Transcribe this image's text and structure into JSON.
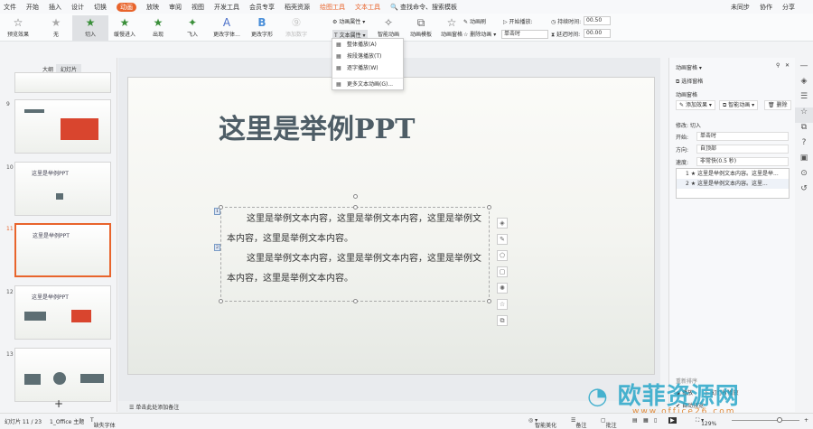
{
  "menubar": {
    "items": [
      "文件",
      "开始",
      "插入",
      "设计",
      "切换",
      "动画",
      "放映",
      "审阅",
      "视图",
      "开发工具",
      "会员专享",
      "稻壳资源"
    ],
    "active": "动画",
    "context_tabs": [
      "绘图工具",
      "文本工具"
    ],
    "search": "查找命令、搜索模板",
    "right": [
      "未同步",
      "协作",
      "分享"
    ]
  },
  "ribbon": {
    "preview": "预览效果",
    "effects": [
      "无",
      "切入",
      "缓慢进入",
      "出现",
      "飞入",
      "更改字体...",
      "更改字形",
      "添加数字"
    ],
    "anim_props": "动画属性",
    "text_props": "文本属性",
    "smart_anim": "智能动画",
    "anim_template": "动画模板",
    "anim_pane": "动画窗格",
    "anim_brush": "动画刷",
    "delete_anim": "删除动画",
    "start_play": "开始播放:",
    "start_value": "单击时",
    "duration_label": "持续时间:",
    "duration": "00.50",
    "delay_label": "延迟时间:",
    "delay": "00.00"
  },
  "dropdown": {
    "items": [
      "整体播放(A)",
      "按段落播放(T)",
      "逐字播放(W)"
    ],
    "more": "更多文本动画(G)..."
  },
  "left_panel": {
    "tabs": [
      "大纲",
      "幻灯片"
    ],
    "slides": [
      {
        "num": "9",
        "title": ""
      },
      {
        "num": "10",
        "title": "这里是举例PPT"
      },
      {
        "num": "11",
        "title": "这里是举例PPT"
      },
      {
        "num": "12",
        "title": "这里是举例PPT"
      },
      {
        "num": "13",
        "title": ""
      }
    ],
    "add": "+"
  },
  "slide": {
    "title": "这里是举例PPT",
    "paragraphs": [
      "这里是举例文本内容，这里是举例文本内容，这里是举例文本内容，这里是举例文本内容。",
      "这里是举例文本内容，这里是举例文本内容，这里是举例文本内容，这里是举例文本内容。"
    ],
    "tags": [
      "1",
      "2"
    ]
  },
  "notes": {
    "placeholder": "单击此处添加备注"
  },
  "right_panel": {
    "title": "动画窗格",
    "select_pane": "选择窗格",
    "section": "动画窗格",
    "add_effect": "添加效果",
    "smart": "智能动画",
    "delete": "删除",
    "modify": "修改: 切入",
    "start_label": "开始:",
    "start": "单击时",
    "direction_label": "方向:",
    "direction": "自顶部",
    "speed_label": "速度:",
    "speed": "非常快(0.5 秒)",
    "list": [
      "1 ★ 这里是举例文本内容。这里是举...",
      "2 ★ 这里是举例文本内容。这里..."
    ],
    "reorder": "重新排序",
    "play": "播放",
    "slideshow": "幻灯片播放",
    "autopreview": "自动预览"
  },
  "statusbar": {
    "slide": "幻灯片 11 / 23",
    "theme": "1_Office 主题",
    "font": "缺失字体",
    "beautify": "智能美化",
    "notes": "备注",
    "comment": "批注",
    "zoom": "129%"
  },
  "watermark": {
    "text": "欧菲资源网",
    "url": "www.office26.com"
  },
  "colors": {
    "accent": "#e8642c"
  }
}
